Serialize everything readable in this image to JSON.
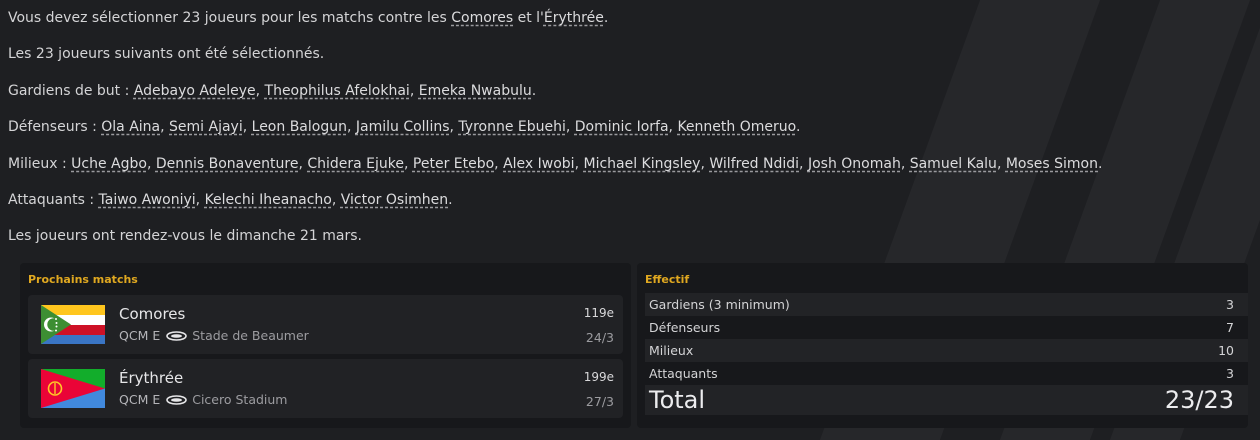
{
  "message": {
    "intro_prefix": "Vous devez sélectionner 23 joueurs pour les matchs contre les ",
    "opponent1": "Comores",
    "intro_mid": " et l'",
    "opponent2": "Érythrée",
    "intro_suffix": ".",
    "selected_line": "Les 23 joueurs suivants ont été sélectionnés.",
    "goalkeepers_label": "Gardiens de but : ",
    "goalkeepers": [
      "Adebayo Adeleye",
      "Theophilus Afelokhai",
      "Emeka Nwabulu"
    ],
    "defenders_label": "Défenseurs : ",
    "defenders": [
      "Ola Aina",
      "Semi Ajayi",
      "Leon Balogun",
      "Jamilu Collins",
      "Tyronne Ebuehi",
      "Dominic Iorfa",
      "Kenneth Omeruo"
    ],
    "midfielders_label": "Milieux : ",
    "midfielders": [
      "Uche Agbo",
      "Dennis Bonaventure",
      "Chidera Ejuke",
      "Peter Etebo",
      "Alex Iwobi",
      "Michael Kingsley",
      "Wilfred Ndidi",
      "Josh Onomah",
      "Samuel Kalu",
      "Moses Simon"
    ],
    "attackers_label": "Attaquants : ",
    "attackers": [
      "Taiwo Awoniyi",
      "Kelechi Iheanacho",
      "Victor Osimhen"
    ],
    "separator": ", ",
    "end_mark": ".",
    "meeting_line": "Les joueurs ont rendez-vous le dimanche 21 mars."
  },
  "upcoming": {
    "title": "Prochains matchs",
    "matches": [
      {
        "team": "Comores",
        "rank": "119e",
        "competition": "QCM E",
        "stadium": "Stade de Beaumer",
        "date": "24/3",
        "flag": "comoros-flag"
      },
      {
        "team": "Érythrée",
        "rank": "199e",
        "competition": "QCM E",
        "stadium": "Cicero Stadium",
        "date": "27/3",
        "flag": "eritrea-flag"
      }
    ]
  },
  "squad": {
    "title": "Effectif",
    "rows": [
      {
        "label": "Gardiens (3 minimum)",
        "value": "3"
      },
      {
        "label": "Défenseurs",
        "value": "7"
      },
      {
        "label": "Milieux",
        "value": "10"
      },
      {
        "label": "Attaquants",
        "value": "3"
      }
    ],
    "total_label": "Total",
    "total_value": "23/23"
  },
  "colors": {
    "background": "#1e1f22",
    "panel": "#17181b",
    "card": "#212225",
    "accent": "#e0a820",
    "text": "#d4d4d6"
  }
}
